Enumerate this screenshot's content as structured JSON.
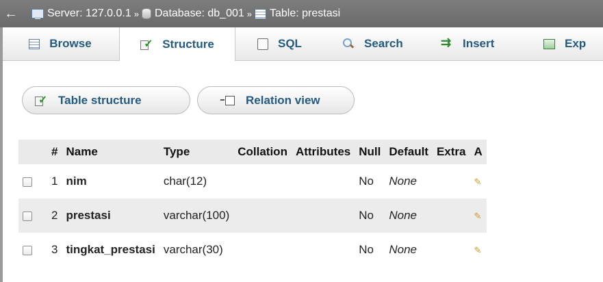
{
  "breadcrumb": {
    "server_label": "Server: 127.0.0.1",
    "database_label": "Database: db_001",
    "table_label": "Table: prestasi",
    "separator": "»"
  },
  "tabs": [
    {
      "label": "Browse",
      "icon": "browse-icon"
    },
    {
      "label": "Structure",
      "icon": "structure-icon",
      "active": true
    },
    {
      "label": "SQL",
      "icon": "sql-icon"
    },
    {
      "label": "Search",
      "icon": "search-icon"
    },
    {
      "label": "Insert",
      "icon": "insert-icon"
    },
    {
      "label": "Exp",
      "icon": "export-icon"
    }
  ],
  "subnav": {
    "table_structure_label": "Table structure",
    "relation_view_label": "Relation view"
  },
  "table": {
    "headers": [
      "#",
      "Name",
      "Type",
      "Collation",
      "Attributes",
      "Null",
      "Default",
      "Extra",
      "A"
    ],
    "rows": [
      {
        "num": "1",
        "name": "nim",
        "type": "char(12)",
        "collation": "",
        "attributes": "",
        "null": "No",
        "default": "None",
        "extra": ""
      },
      {
        "num": "2",
        "name": "prestasi",
        "type": "varchar(100)",
        "collation": "",
        "attributes": "",
        "null": "No",
        "default": "None",
        "extra": ""
      },
      {
        "num": "3",
        "name": "tingkat_prestasi",
        "type": "varchar(30)",
        "collation": "",
        "attributes": "",
        "null": "No",
        "default": "None",
        "extra": ""
      }
    ]
  },
  "colors": {
    "tab_text": "#235a81",
    "breadcrumb_bg": "#707070",
    "header_bg": "#eaeaea"
  }
}
